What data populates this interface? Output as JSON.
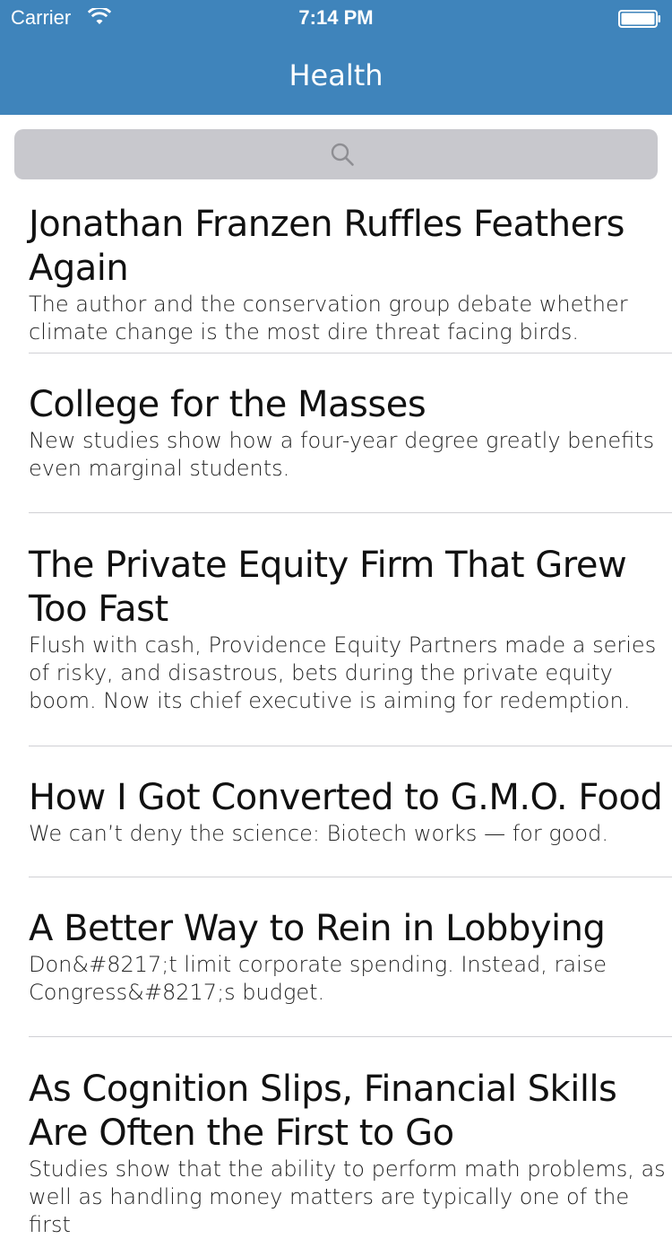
{
  "status_bar": {
    "carrier": "Carrier",
    "time": "7:14 PM"
  },
  "nav": {
    "title": "Health"
  },
  "search": {
    "icon": "search-icon"
  },
  "colors": {
    "header": "#3f84bb",
    "search_bg": "#c8c8cd",
    "divider": "#d0d0d4"
  },
  "articles": [
    {
      "title": "Jonathan Franzen Ruffles Feathers Again",
      "summary": "The author and the conservation group debate whether climate change is the most dire threat facing birds."
    },
    {
      "title": "College for the Masses",
      "summary": "New studies show how a four-year degree greatly benefits even marginal students."
    },
    {
      "title": "The Private Equity Firm That Grew Too Fast",
      "summary": "Flush with cash, Providence Equity Partners made a series of risky, and disastrous, bets during the private equity boom. Now its chief executive is aiming for redemption."
    },
    {
      "title": "How I Got Converted to G.M.O. Food",
      "summary": "We can’t deny the science: Biotech works — for good."
    },
    {
      "title": "A Better Way to Rein in Lobbying",
      "summary": "Don&#8217;t limit corporate spending. Instead, raise Congress&#8217;s budget."
    },
    {
      "title": "As Cognition Slips, Financial Skills Are Often the First to Go",
      "summary": "Studies show that the ability to perform math problems, as well as handling money matters are typically one of the first"
    }
  ]
}
